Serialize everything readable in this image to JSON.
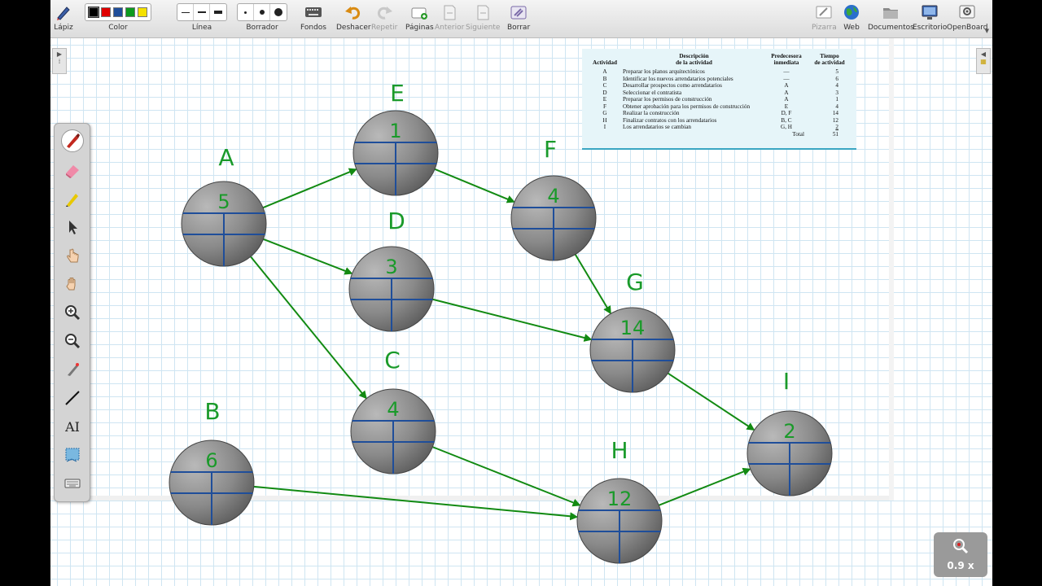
{
  "toolbar": {
    "pen": "Lápiz",
    "color": "Color",
    "line": "Línea",
    "eraser": "Borrador",
    "backgrounds": "Fondos",
    "undo": "Deshacer",
    "redo": "Repetir",
    "pages": "Páginas",
    "previous": "Anterior",
    "next": "Siguiente",
    "clear": "Borrar",
    "board": "Pizarra",
    "web": "Web",
    "documents": "Documentos",
    "desktop": "Escritorio",
    "openboard": "OpenBoard"
  },
  "colors": {
    "palette": [
      "#000000",
      "#e00000",
      "#1f4e9a",
      "#0c9a1e",
      "#f5e100"
    ],
    "arrow": "#128a12",
    "ink": "#1a9a2a",
    "grid": "#cfe5f2",
    "node_line": "#1f4e9a"
  },
  "activity_table": {
    "headers": {
      "activity": "Actividad",
      "description_1": "Descripción",
      "description_2": "de la actividad",
      "predecessor_1": "Predecesora",
      "predecessor_2": "inmediata",
      "time_1": "Tiempo",
      "time_2": "de actividad"
    },
    "rows": [
      {
        "act": "A",
        "desc": "Preparar los planos arquitectónicos",
        "pred": "—",
        "time": "5"
      },
      {
        "act": "B",
        "desc": "Identificar los nuevos arrendatarios potenciales",
        "pred": "—",
        "time": "6"
      },
      {
        "act": "C",
        "desc": "Desarrollar prospectos como arrendatarios",
        "pred": "A",
        "time": "4"
      },
      {
        "act": "D",
        "desc": "Seleccionar el contratista",
        "pred": "A",
        "time": "3"
      },
      {
        "act": "E",
        "desc": "Preparar los permisos de construcción",
        "pred": "A",
        "time": "1"
      },
      {
        "act": "F",
        "desc": "Obtener aprobación para los permisos de construcción",
        "pred": "E",
        "time": "4"
      },
      {
        "act": "G",
        "desc": "Realizar la construcción",
        "pred": "D, F",
        "time": "14"
      },
      {
        "act": "H",
        "desc": "Finalizar contratos con los arrendatarios",
        "pred": "B, C",
        "time": "12"
      },
      {
        "act": "I",
        "desc": "Los arrendatarios se cambian",
        "pred": "G, H",
        "time": "2"
      }
    ],
    "total_label": "Total",
    "total_value": "51"
  },
  "nodes": [
    {
      "id": "A",
      "letter": "A",
      "time": "5"
    },
    {
      "id": "B",
      "letter": "B",
      "time": "6"
    },
    {
      "id": "C",
      "letter": "C",
      "time": "4"
    },
    {
      "id": "D",
      "letter": "D",
      "time": "3"
    },
    {
      "id": "E",
      "letter": "E",
      "time": "1"
    },
    {
      "id": "F",
      "letter": "F",
      "time": "4"
    },
    {
      "id": "G",
      "letter": "G",
      "time": "14"
    },
    {
      "id": "H",
      "letter": "H",
      "time": "12"
    },
    {
      "id": "I",
      "letter": "I",
      "time": "2"
    }
  ],
  "edges": [
    [
      "A",
      "E"
    ],
    [
      "A",
      "D"
    ],
    [
      "A",
      "C"
    ],
    [
      "E",
      "F"
    ],
    [
      "F",
      "G"
    ],
    [
      "D",
      "G"
    ],
    [
      "C",
      "H"
    ],
    [
      "B",
      "H"
    ],
    [
      "G",
      "I"
    ],
    [
      "H",
      "I"
    ]
  ],
  "zoom": {
    "label": "0.9 x"
  },
  "icons": [
    "pen-icon",
    "keyboard-icon",
    "undo-icon",
    "redo-icon",
    "pages-icon",
    "previous-icon",
    "next-icon",
    "clear-icon",
    "board-icon",
    "web-icon",
    "documents-icon",
    "desktop-icon",
    "openboard-icon",
    "zoom-icon"
  ]
}
